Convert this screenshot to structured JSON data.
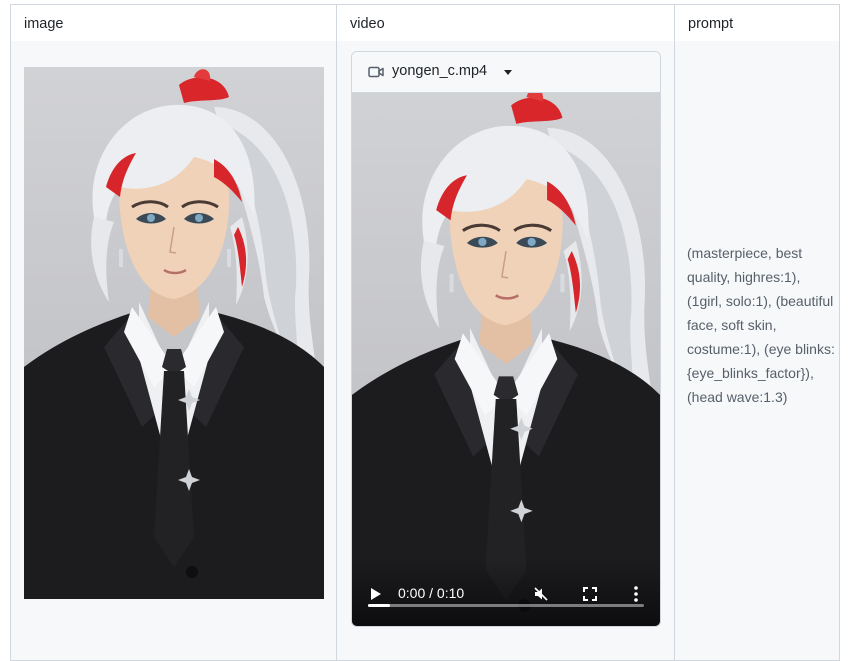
{
  "table": {
    "headers": [
      "image",
      "video",
      "prompt"
    ]
  },
  "video": {
    "filename": "yongen_c.mp4",
    "time": "0:00 / 0:10",
    "progress_fraction": 0.08
  },
  "prompt": {
    "text": "(masterpiece, best quality, highres:1), (1girl, solo:1), (beautiful face, soft skin, costume:1), (eye blinks: {eye_blinks_factor}), (head wave:1.3)"
  },
  "colors": {
    "border": "#d0d7de",
    "cell_bg": "#f6f8fa",
    "prompt_text": "#57606a",
    "hair_accent": "#e02020"
  },
  "icons": [
    "video-camera-icon",
    "caret-down-icon",
    "play-icon",
    "mute-icon",
    "fullscreen-icon",
    "more-vertical-icon"
  ]
}
